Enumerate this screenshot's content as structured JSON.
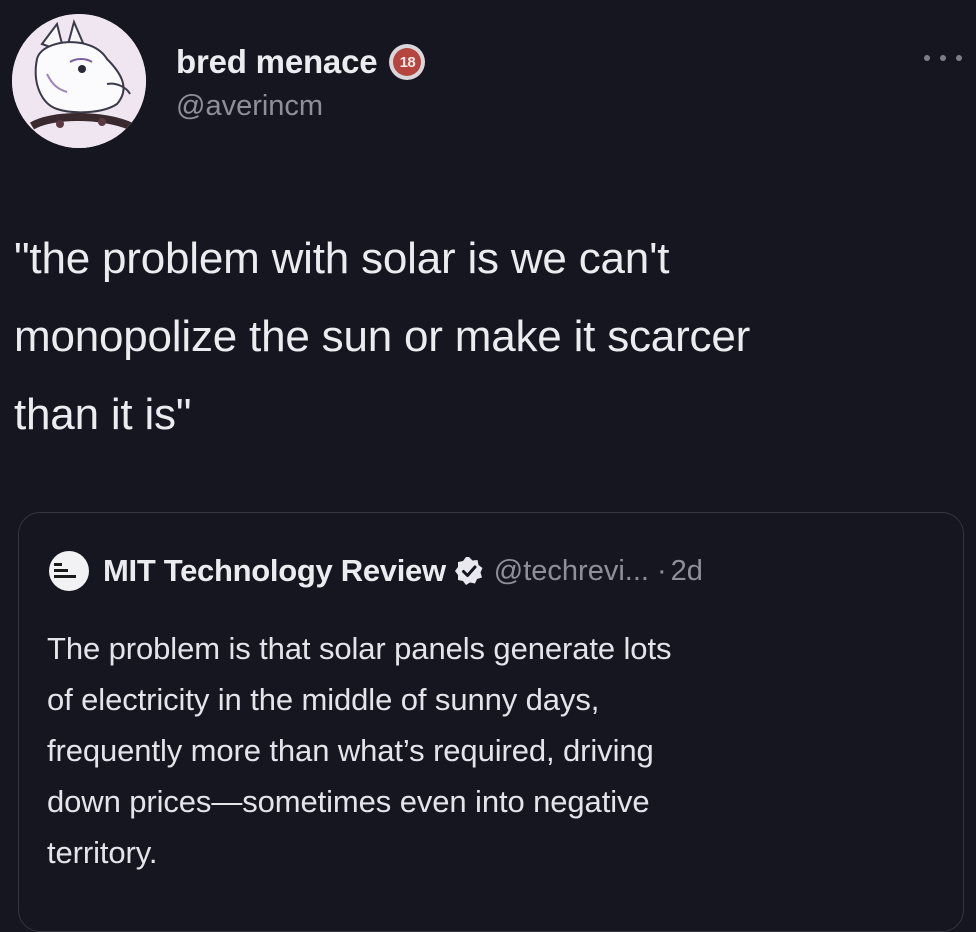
{
  "tweet": {
    "display_name": "bred menace",
    "age_badge": "18",
    "handle": "@averincm",
    "avatar_icon": "fox-avatar-icon",
    "more_icon": "more-options-icon",
    "text": "\"the problem with solar is we can't\nmonopolize the sun or make it scarcer\nthan it is\""
  },
  "quote": {
    "logo_icon": "mit-technology-review-logo-icon",
    "name": "MIT Technology Review",
    "verified_icon": "verified-badge-icon",
    "handle": "@techrevi...",
    "separator": "·",
    "time": "2d",
    "text": "The problem is that solar panels generate lots\nof electricity in the middle of sunny days,\nfrequently more than what’s required, driving\ndown prices—sometimes even into negative\nterritory."
  },
  "colors": {
    "background": "#15161f",
    "text": "#ececf0",
    "muted": "#8e8f99",
    "border": "#34353f",
    "badge": "#b5463f"
  }
}
